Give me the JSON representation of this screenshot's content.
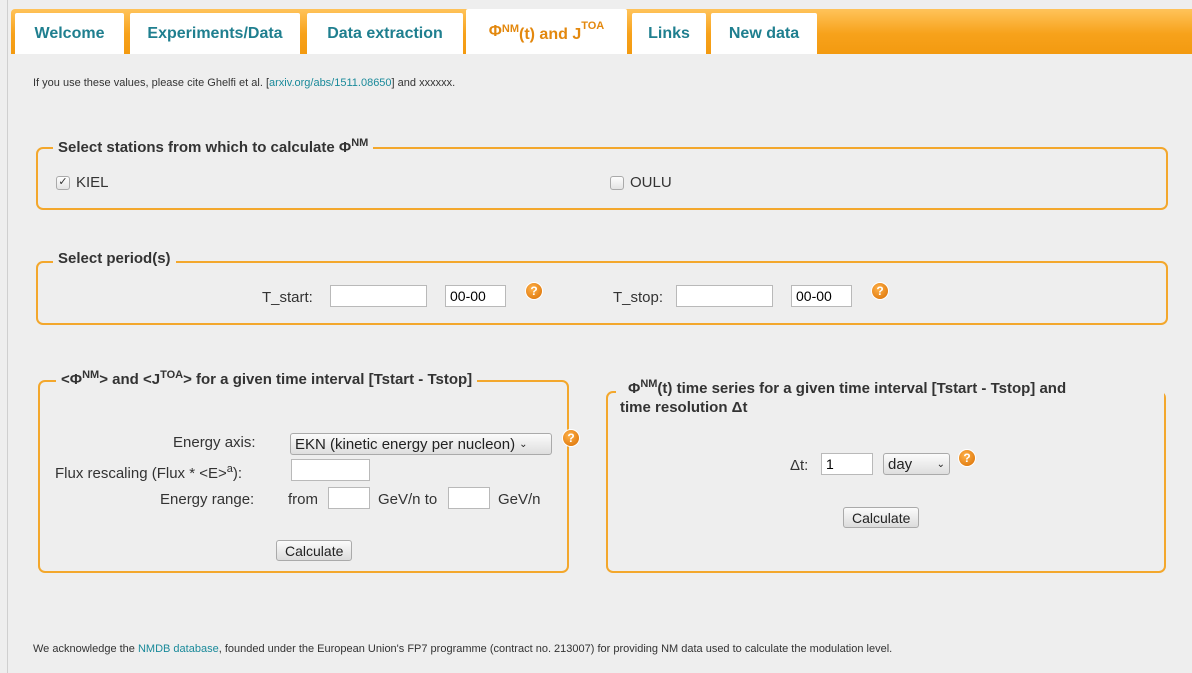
{
  "tabs": [
    {
      "label": "Welcome"
    },
    {
      "label": "Experiments/Data"
    },
    {
      "label": "Data extraction"
    },
    {
      "label_parts": [
        "Φ",
        "NM",
        "(t) and J",
        "TOA"
      ]
    },
    {
      "label": "Links"
    },
    {
      "label": "New data"
    }
  ],
  "cite": {
    "prefix": "If you use these values, please cite Ghelfi et al. [",
    "link": "arxiv.org/abs/1511.08650",
    "suffix": "] and xxxxxx."
  },
  "stations": {
    "legend_text": "Select stations from which to calculate Φ",
    "legend_sup": "NM",
    "items": [
      {
        "label": "KIEL",
        "checked": true
      },
      {
        "label": "OULU",
        "checked": false
      }
    ]
  },
  "period": {
    "legend": "Select period(s)",
    "tstart_label": "T_start:",
    "tstart_date": "",
    "tstart_time": "00-00",
    "tstop_label": "T_stop:",
    "tstop_date": "",
    "tstop_time": "00-00"
  },
  "interval": {
    "legend_parts": [
      "<Φ",
      "NM",
      "> and <J",
      "TOA",
      "> for a given time interval [Tstart - Tstop]"
    ],
    "energy_axis_label": "Energy axis:",
    "energy_axis_value": "EKN (kinetic energy per nucleon)",
    "flux_label_pre": "Flux rescaling (Flux * <E>",
    "flux_label_sup": "a",
    "flux_label_post": "):",
    "flux_value": "",
    "range_label": "Energy range:",
    "from_label": "from",
    "from_value": "",
    "unit_to": "GeV/n to",
    "to_value": "",
    "unit": "GeV/n",
    "calculate": "Calculate"
  },
  "series": {
    "legend_parts": [
      "Φ",
      "NM",
      "(t) time series for a given time interval [Tstart - Tstop] and"
    ],
    "legend_line2": "time resolution Δt",
    "dt_label": "Δt:",
    "dt_value": "1",
    "unit_value": "day",
    "calculate": "Calculate"
  },
  "ack": {
    "prefix": "We acknowledge the ",
    "link": "NMDB database",
    "suffix": ", founded under the European Union's FP7 programme (contract no. 213007) for providing NM data used to calculate the modulation level."
  },
  "help_glyph": "?",
  "colors": {
    "accent": "#f3a72c",
    "tab_text": "#1f7f8f",
    "active_tab_text": "#e3880e",
    "link": "#1a8a9a"
  }
}
